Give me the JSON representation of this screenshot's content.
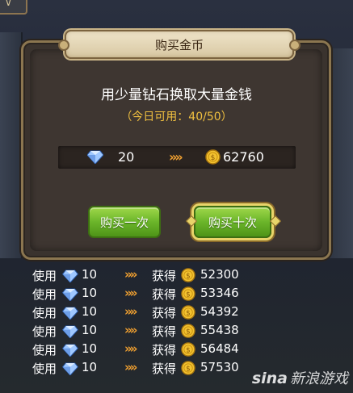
{
  "dialog": {
    "title": "购买金币",
    "headline": "用少量钻石换取大量金钱",
    "today_limit": "（今日可用：40/50）"
  },
  "exchange": {
    "diamond_cost": "20",
    "arrows": "»»",
    "gold_gain": "62760"
  },
  "buttons": {
    "buy_once": "购买一次",
    "buy_ten": "购买十次"
  },
  "price_list": [
    {
      "use": "使用",
      "cost": "10",
      "get": "获得",
      "gold": "52300"
    },
    {
      "use": "使用",
      "cost": "10",
      "get": "获得",
      "gold": "53346"
    },
    {
      "use": "使用",
      "cost": "10",
      "get": "获得",
      "gold": "54392"
    },
    {
      "use": "使用",
      "cost": "10",
      "get": "获得",
      "gold": "55438"
    },
    {
      "use": "使用",
      "cost": "10",
      "get": "获得",
      "gold": "56484"
    },
    {
      "use": "使用",
      "cost": "10",
      "get": "获得",
      "gold": "57530"
    }
  ],
  "watermark": {
    "logo": "sina",
    "text": "新浪游戏"
  },
  "colors": {
    "gold_text": "#f0c040",
    "arrow": "#f0a030",
    "button_green": "#6bb52a",
    "frame": "#8b7650"
  },
  "icons": {
    "diamond": "diamond-icon",
    "coin": "gold-coin-icon",
    "arrows": "double-chevron-icon"
  }
}
